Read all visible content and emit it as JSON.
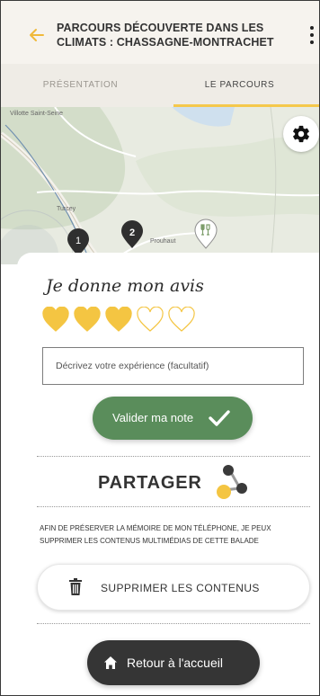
{
  "header": {
    "title": "PARCOURS DÉCOUVERTE DANS LES CLIMATS : CHASSAGNE-MONTRACHET",
    "back_icon": "arrow-left-icon",
    "menu_icon": "more-vertical-icon"
  },
  "tabs": [
    {
      "label": "PRÉSENTATION",
      "selected": false
    },
    {
      "label": "LE PARCOURS",
      "selected": true
    }
  ],
  "map": {
    "place_labels": [
      "Villotte Saint-Seine",
      "Turcey",
      "Prouhaut"
    ],
    "markers": [
      "1",
      "2"
    ],
    "settings_icon": "gear-icon",
    "poi_icon": "wine-glasses-icon"
  },
  "rating": {
    "title": "Je donne mon avis",
    "stars_filled": 3,
    "stars_total": 5,
    "heart_icon": "heart-icon",
    "experience_placeholder": "Décrivez votre expérience (facultatif)",
    "validate_label": "Valider ma note",
    "validate_icon": "check-icon"
  },
  "share": {
    "title": "PARTAGER",
    "icon": "share-icon"
  },
  "notice": "AFIN DE PRÉSERVER LA MÉMOIRE DE MON TÉLÉPHONE, JE PEUX SUPPRIMER LES CONTENUS MULTIMÉDIAS DE CETTE BALADE",
  "delete": {
    "label": "SUPPRIMER LES CONTENUS",
    "icon": "trash-icon"
  },
  "home": {
    "label": "Retour à l'accueil",
    "icon": "home-icon"
  },
  "colors": {
    "accent": "#f5c84c",
    "validate_green": "#5a8d5b",
    "home_dark": "#353535"
  }
}
